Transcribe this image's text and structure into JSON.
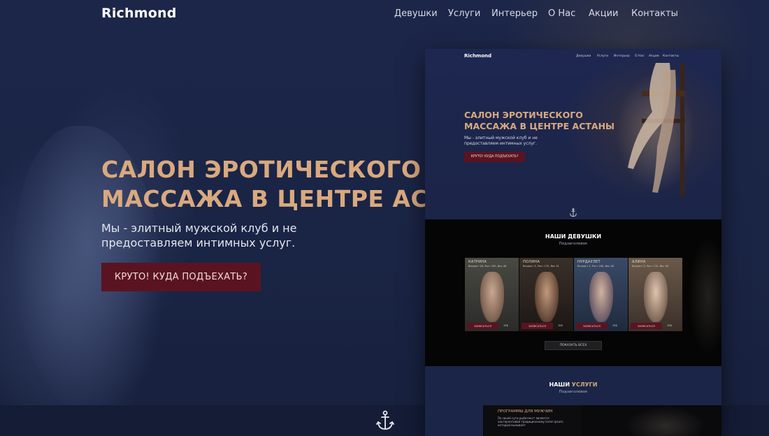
{
  "brand": {
    "logo": "Richmond"
  },
  "nav": {
    "items": [
      "Девушки",
      "Услуги",
      "Интерьер",
      "О Нас",
      "Акции",
      "Контакты"
    ]
  },
  "hero": {
    "title_line1": "САЛОН ЭРОТИЧЕСКОГО",
    "title_line2": "МАССАЖА В ЦЕНТРЕ АСТАНЫ",
    "subtitle": "Мы - элитный мужской клуб и не предоставляем интимных услуг.",
    "cta": "КРУТО! КУДА ПОДЪЕХАТЬ?"
  },
  "colors": {
    "accent": "#d9a97e",
    "background": "#1b2547",
    "cta": "#5a1421"
  },
  "icons": {
    "anchor": "anchor-icon"
  },
  "mockup": {
    "logo": "Richmond",
    "nav": [
      "Девушки",
      "Услуги",
      "Интерьер",
      "О Нас",
      "Акции",
      "Контакты"
    ],
    "hero_title_line1": "САЛОН ЭРОТИЧЕСКОГО",
    "hero_title_line2": "МАССАЖА В ЦЕНТРЕ АСТАНЫ",
    "hero_subtitle": "Мы - элитный мужской клуб и не предоставляем интимных услуг.",
    "hero_cta": "КРУТО! КУДА ПОДЪЕХАТЬ?",
    "girls": {
      "title": "НАШИ ДЕВУШКИ",
      "subtitle": "Подзаголовок",
      "cards": [
        {
          "name": "КАТРИНА",
          "meta": "Возраст 28, Рост 165, Вес 48",
          "button": "ЗАПИСАТЬСЯ",
          "price": "15$"
        },
        {
          "name": "ПОЛИНА",
          "meta": "Возраст 3, Рост 170, Вес 51",
          "button": "ЗАПИСАТЬСЯ",
          "price": "15$"
        },
        {
          "name": "НУРДАУЛЕТ",
          "meta": "Возраст 3, Рост 165, Вес 48",
          "button": "ЗАПИСАТЬСЯ",
          "price": "15$"
        },
        {
          "name": "АЛИНА",
          "meta": "Возраст 3, Рост 170, Вес 48",
          "button": "ЗАПИСАТЬСЯ",
          "price": "15$"
        }
      ],
      "show_all": "ПОКАЗАТЬ ВСЕХ"
    },
    "services": {
      "title_part1": "НАШИ ",
      "title_part2": "УСЛУГИ",
      "subtitle": "Подзаголовок",
      "program_title": "ПРОГРАММЫ ДЛЯ МУЖЧИН",
      "program_text": "По своей сути рыбатекст является альтернативой традиционному lorem ipsum, который вызывает"
    }
  }
}
